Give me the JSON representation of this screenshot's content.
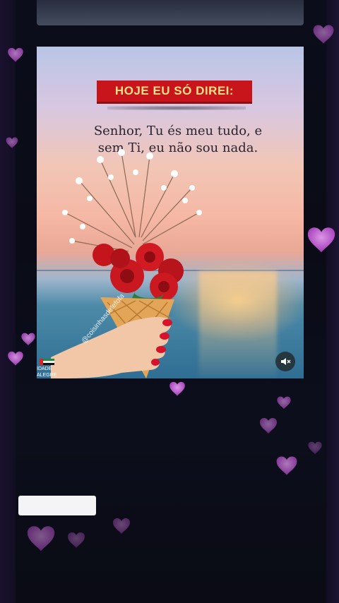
{
  "post": {
    "banner_text": "HOJE EU SÓ DIREI:",
    "quote_line1": "Senhor, Tu és meu tudo, e",
    "quote_line2": "sem Ti, eu não sou nada.",
    "watermark": "@coisinhasdefefofa",
    "corner_logo_text": "IDADE ALEGRE",
    "mute_icon": "speaker-muted-icon"
  },
  "caption": {
    "text": ""
  },
  "colors": {
    "banner_red": "#c8151b",
    "banner_text": "#ffe08a",
    "heart_pink": "#d868e6",
    "background": "#07080f"
  }
}
